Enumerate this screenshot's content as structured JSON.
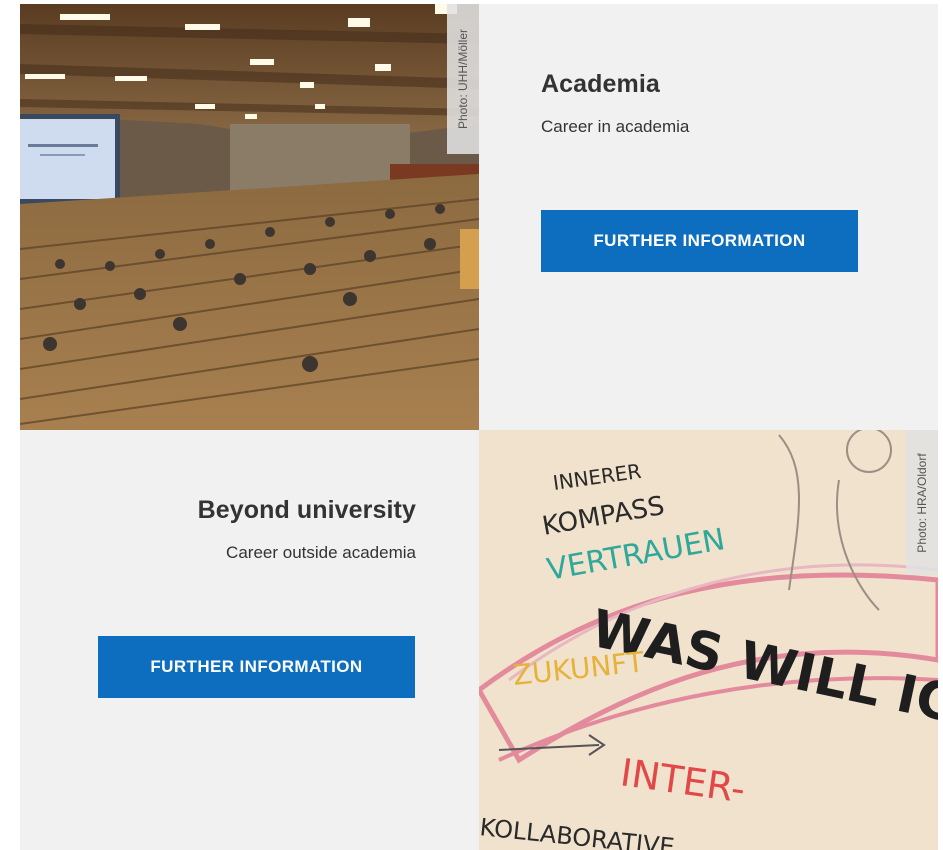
{
  "cards": [
    {
      "title": "Academia",
      "subtitle": "Career in academia",
      "button_label": "FURTHER INFORMATION",
      "photo_credit": "Photo: UHH/Möller"
    },
    {
      "title": "Beyond university",
      "subtitle": "Career outside academia",
      "button_label": "FURTHER INFORMATION",
      "photo_credit": "Photo: HRA/Oldorf"
    }
  ],
  "illustration_words": {
    "w1": "INNERER",
    "w2": "KOMPASS",
    "w3": "VERTRAUEN",
    "w4": "WAS WILL ICH ?",
    "w5": "ZUKUNFT",
    "w6": "INTER-",
    "w7": "KOLLABORATIVE"
  },
  "colors": {
    "button": "#0d6ebf",
    "panel": "#f1f1f1",
    "text": "#333333"
  }
}
